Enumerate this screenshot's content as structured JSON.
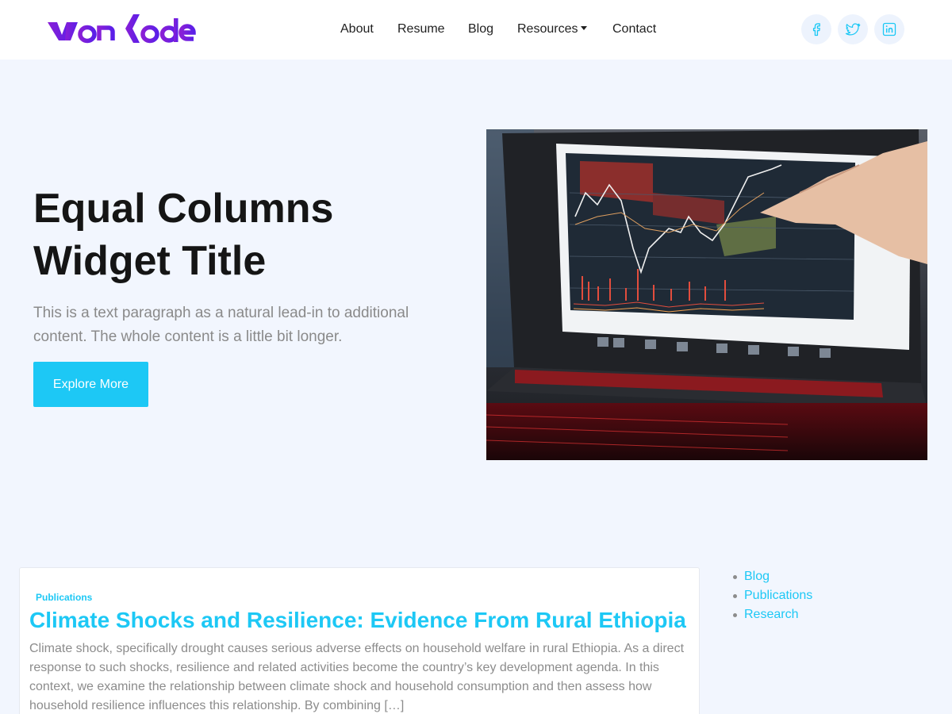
{
  "brand": {
    "logo_text": "WonCode"
  },
  "nav": {
    "items": [
      {
        "label": "About"
      },
      {
        "label": "Resume"
      },
      {
        "label": "Blog"
      },
      {
        "label": "Resources",
        "has_dropdown": true
      },
      {
        "label": "Contact"
      }
    ]
  },
  "social": [
    {
      "icon": "facebook-icon"
    },
    {
      "icon": "twitter-icon"
    },
    {
      "icon": "linkedin-icon"
    }
  ],
  "hero": {
    "title": "Equal Columns Widget Title",
    "text": "This is a text paragraph as a natural lead-in to additional content. The whole content is a little bit longer.",
    "button_label": "Explore More",
    "image_alt": "laptop showing trading chart"
  },
  "post": {
    "category": "Publications",
    "title": "Climate Shocks and Resilience: Evidence From Rural Ethiopia",
    "excerpt": "Climate shock, specifically drought causes serious adverse effects on household welfare in rural Ethiopia. As a direct response to such shocks, resilience and related activities become the country’s key development agenda. In this context, we examine the relationship between climate shock and household consumption and then assess how household resilience influences this relationship. By combining […]"
  },
  "sidebar": {
    "categories": [
      {
        "label": "Blog"
      },
      {
        "label": "Publications"
      },
      {
        "label": "Research"
      }
    ]
  },
  "colors": {
    "accent": "#1dc8f5",
    "logo_purple": "#7a1fe0",
    "background": "#f2f6fe"
  }
}
